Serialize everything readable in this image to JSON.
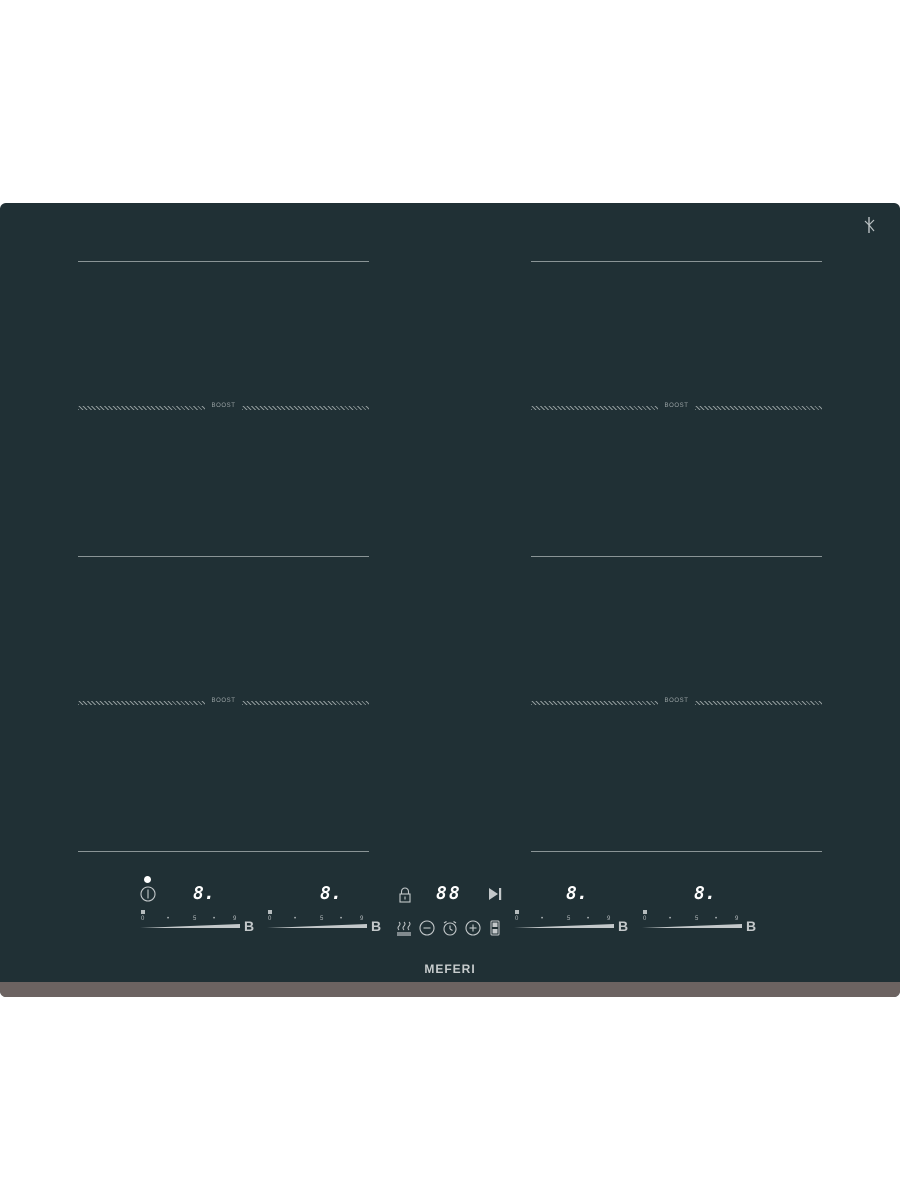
{
  "brand": "MEFERI",
  "zones": {
    "boost_label": "BOOST"
  },
  "displays": {
    "zone1": "8.",
    "zone2": "8.",
    "timer": "88",
    "zone3": "8.",
    "zone4": "8."
  },
  "slider": {
    "tick_0": "0",
    "tick_dot1": "•",
    "tick_5": "5",
    "tick_dot2": "•",
    "tick_9": "9",
    "boost": "B"
  },
  "icons": {
    "power": "power-icon",
    "lock": "lock-icon",
    "pause": "play-pause-icon",
    "keep_warm": "keep-warm-icon",
    "minus": "minus-icon",
    "timer": "timer-icon",
    "plus": "plus-icon",
    "bridge": "bridge-icon",
    "wifi": "hood-connect-icon"
  },
  "colors": {
    "glass": "#203035",
    "lines": "#8a9496",
    "display": "#ffffff",
    "trim": "#6c6361"
  }
}
